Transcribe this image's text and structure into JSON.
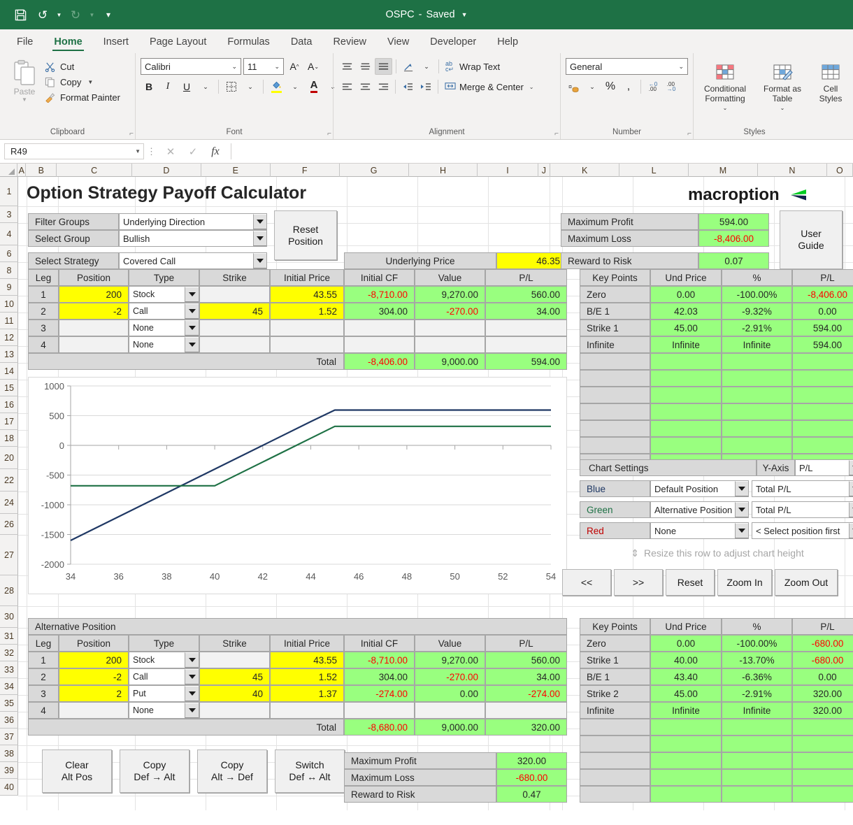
{
  "titlebar": {
    "doc_name": "OSPC",
    "saved_state": "Saved",
    "save_icon": "save-icon",
    "undo_icon": "undo-icon",
    "redo_icon": "redo-icon",
    "customize_icon": "customize-qat-icon"
  },
  "tabs": [
    {
      "label": "File",
      "active": false
    },
    {
      "label": "Home",
      "active": true
    },
    {
      "label": "Insert",
      "active": false
    },
    {
      "label": "Page Layout",
      "active": false
    },
    {
      "label": "Formulas",
      "active": false
    },
    {
      "label": "Data",
      "active": false
    },
    {
      "label": "Review",
      "active": false
    },
    {
      "label": "View",
      "active": false
    },
    {
      "label": "Developer",
      "active": false
    },
    {
      "label": "Help",
      "active": false
    }
  ],
  "ribbon": {
    "clipboard": {
      "group_label": "Clipboard",
      "paste_label": "Paste",
      "cut_label": "Cut",
      "copy_label": "Copy",
      "format_painter_label": "Format Painter"
    },
    "font": {
      "group_label": "Font",
      "font_name": "Calibri",
      "font_size": "11",
      "grow_font": "A",
      "shrink_font": "A",
      "bold": "B",
      "italic": "I",
      "underline": "U",
      "fill_color": "A",
      "font_color": "A"
    },
    "alignment": {
      "group_label": "Alignment",
      "wrap_text_label": "Wrap Text",
      "merge_center_label": "Merge & Center"
    },
    "number": {
      "group_label": "Number",
      "format_value": "General",
      "percent": "%",
      "comma": ",",
      "increase_decimal": ".00",
      "decrease_decimal": ".00"
    },
    "styles": {
      "group_label": "Styles",
      "conditional_formatting": "Conditional Formatting",
      "format_as_table": "Format as Table",
      "cell_styles": "Cell Styles"
    }
  },
  "formula_bar": {
    "name_box": "R49",
    "cancel_icon": "cancel-icon",
    "enter_icon": "confirm-icon",
    "fx_icon": "insert-function-icon",
    "formula_value": ""
  },
  "grid": {
    "columns": [
      "A",
      "B",
      "C",
      "D",
      "E",
      "F",
      "G",
      "H",
      "I",
      "J",
      "K",
      "L",
      "M",
      "N",
      "O"
    ],
    "rows": [
      1,
      3,
      4,
      6,
      8,
      9,
      10,
      11,
      12,
      13,
      14,
      15,
      16,
      17,
      18,
      20,
      22,
      24,
      26,
      27,
      28,
      30,
      31,
      32,
      33,
      34,
      35,
      36,
      37,
      38,
      39,
      40
    ]
  },
  "sheet": {
    "title": "Option Strategy Payoff Calculator",
    "brand": "macroption",
    "selectors": [
      {
        "label": "Filter Groups",
        "value": "Underlying Direction"
      },
      {
        "label": "Select Group",
        "value": "Bullish"
      },
      {
        "label": "Select Strategy",
        "value": "Covered Call"
      }
    ],
    "reset_button": "Reset\nPosition",
    "reset_button_line1": "Reset",
    "reset_button_line2": "Position",
    "user_guide_line1": "User",
    "user_guide_line2": "Guide",
    "underlying_price_label": "Underlying Price",
    "underlying_price_value": "46.35",
    "summary_top": [
      {
        "label": "Maximum Profit",
        "value": "594.00",
        "negative": false
      },
      {
        "label": "Maximum Loss",
        "value": "-8,406.00",
        "negative": true
      },
      {
        "label": "Reward to Risk",
        "value": "0.07",
        "negative": false
      }
    ],
    "legs_headers": [
      "Leg",
      "Position",
      "Type",
      "Strike",
      "Initial Price",
      "Initial CF",
      "Value",
      "P/L"
    ],
    "legs_default": [
      {
        "leg": "1",
        "position": "200",
        "type": "Stock",
        "strike": "",
        "initial_price": "43.55",
        "initial_cf": "-8,710.00",
        "cf_neg": true,
        "value": "9,270.00",
        "value_neg": false,
        "pl": "560.00",
        "pl_neg": false
      },
      {
        "leg": "2",
        "position": "-2",
        "type": "Call",
        "strike": "45",
        "initial_price": "1.52",
        "initial_cf": "304.00",
        "cf_neg": false,
        "value": "-270.00",
        "value_neg": true,
        "pl": "34.00",
        "pl_neg": false
      },
      {
        "leg": "3",
        "position": "",
        "type": "None",
        "strike": "",
        "initial_price": "",
        "initial_cf": "",
        "cf_neg": false,
        "value": "",
        "value_neg": false,
        "pl": "",
        "pl_neg": false
      },
      {
        "leg": "4",
        "position": "",
        "type": "None",
        "strike": "",
        "initial_price": "",
        "initial_cf": "",
        "cf_neg": false,
        "value": "",
        "value_neg": false,
        "pl": "",
        "pl_neg": false
      }
    ],
    "legs_default_total": {
      "label": "Total",
      "initial_cf": "-8,406.00",
      "cf_neg": true,
      "value": "9,000.00",
      "pl": "594.00"
    },
    "keypoints_headers": [
      "Key Points",
      "Und Price",
      "%",
      "P/L"
    ],
    "keypoints_default": [
      {
        "name": "Zero",
        "und_price": "0.00",
        "pct": "-100.00%",
        "pl": "-8,406.00",
        "pl_neg": true
      },
      {
        "name": "B/E 1",
        "und_price": "42.03",
        "pct": "-9.32%",
        "pl": "0.00",
        "pl_neg": false
      },
      {
        "name": "Strike 1",
        "und_price": "45.00",
        "pct": "-2.91%",
        "pl": "594.00",
        "pl_neg": false
      },
      {
        "name": "Infinite",
        "und_price": "Infinite",
        "pct": "Infinite",
        "pl": "594.00",
        "pl_neg": false
      }
    ],
    "chart_settings": {
      "title": "Chart Settings",
      "yaxis_label": "Y-Axis",
      "yaxis_value": "P/L",
      "rows": [
        {
          "color_label": "Blue",
          "position": "Default Position",
          "series": "Total P/L"
        },
        {
          "color_label": "Green",
          "position": "Alternative Position",
          "series": "Total P/L"
        },
        {
          "color_label": "Red",
          "position": "None",
          "series": "< Select position first"
        }
      ]
    },
    "resize_note": "Resize this row to adjust chart height",
    "chart_buttons": [
      "<<",
      ">>",
      "Reset",
      "Zoom In",
      "Zoom Out"
    ],
    "alt_position_title": "Alternative Position",
    "legs_alt": [
      {
        "leg": "1",
        "position": "200",
        "type": "Stock",
        "strike": "",
        "initial_price": "43.55",
        "initial_cf": "-8,710.00",
        "cf_neg": true,
        "value": "9,270.00",
        "value_neg": false,
        "pl": "560.00",
        "pl_neg": false
      },
      {
        "leg": "2",
        "position": "-2",
        "type": "Call",
        "strike": "45",
        "initial_price": "1.52",
        "initial_cf": "304.00",
        "cf_neg": false,
        "value": "-270.00",
        "value_neg": true,
        "pl": "34.00",
        "pl_neg": false
      },
      {
        "leg": "3",
        "position": "2",
        "type": "Put",
        "strike": "40",
        "initial_price": "1.37",
        "initial_cf": "-274.00",
        "cf_neg": true,
        "value": "0.00",
        "value_neg": false,
        "pl": "-274.00",
        "pl_neg": true
      },
      {
        "leg": "4",
        "position": "",
        "type": "None",
        "strike": "",
        "initial_price": "",
        "initial_cf": "",
        "cf_neg": false,
        "value": "",
        "value_neg": false,
        "pl": "",
        "pl_neg": false
      }
    ],
    "legs_alt_total": {
      "label": "Total",
      "initial_cf": "-8,680.00",
      "cf_neg": true,
      "value": "9,000.00",
      "pl": "320.00"
    },
    "keypoints_alt": [
      {
        "name": "Zero",
        "und_price": "0.00",
        "pct": "-100.00%",
        "pl": "-680.00",
        "pl_neg": true
      },
      {
        "name": "Strike 1",
        "und_price": "40.00",
        "pct": "-13.70%",
        "pl": "-680.00",
        "pl_neg": true
      },
      {
        "name": "B/E 1",
        "und_price": "43.40",
        "pct": "-6.36%",
        "pl": "0.00",
        "pl_neg": false
      },
      {
        "name": "Strike 2",
        "und_price": "45.00",
        "pct": "-2.91%",
        "pl": "320.00",
        "pl_neg": false
      },
      {
        "name": "Infinite",
        "und_price": "Infinite",
        "pct": "Infinite",
        "pl": "320.00",
        "pl_neg": false
      }
    ],
    "bottom_buttons": [
      {
        "line1": "Clear",
        "line2": "Alt Pos"
      },
      {
        "line1": "Copy",
        "line2": "Def → Alt"
      },
      {
        "line1": "Copy",
        "line2": "Alt → Def"
      },
      {
        "line1": "Switch",
        "line2": "Def ↔ Alt"
      }
    ],
    "summary_bottom": [
      {
        "label": "Maximum Profit",
        "value": "320.00",
        "negative": false
      },
      {
        "label": "Maximum Loss",
        "value": "-680.00",
        "negative": true
      },
      {
        "label": "Reward to Risk",
        "value": "0.47",
        "negative": false
      }
    ]
  },
  "colors": {
    "brand_green": "#1e7145",
    "series_blue": "#1f3864",
    "series_green": "#1e7145",
    "highlight_yellow": "#ffff00",
    "result_green": "#99ff7f",
    "negative_red": "#ff0000"
  },
  "chart_data": {
    "type": "line",
    "title": "",
    "xlabel": "",
    "ylabel": "",
    "xlim": [
      34,
      54
    ],
    "ylim": [
      -2000,
      1000
    ],
    "xticks": [
      34,
      36,
      38,
      40,
      42,
      44,
      46,
      48,
      50,
      52,
      54
    ],
    "yticks": [
      1000,
      500,
      0,
      -500,
      -1000,
      -1500,
      -2000
    ],
    "grid": true,
    "legend": "none",
    "series": [
      {
        "name": "Blue - Default Position Total P/L",
        "color": "#1f3864",
        "x": [
          34,
          36,
          38,
          40,
          42,
          44,
          45,
          46,
          48,
          50,
          52,
          54
        ],
        "y": [
          -1600,
          -1200,
          -800,
          -400,
          0,
          400,
          594,
          594,
          594,
          594,
          594,
          594
        ]
      },
      {
        "name": "Green - Alternative Position Total P/L",
        "color": "#1e7145",
        "x": [
          34,
          36,
          38,
          40,
          42,
          44,
          45,
          46,
          48,
          50,
          52,
          54
        ],
        "y": [
          -680,
          -680,
          -680,
          -680,
          -280,
          120,
          320,
          320,
          320,
          320,
          320,
          320
        ]
      }
    ]
  }
}
